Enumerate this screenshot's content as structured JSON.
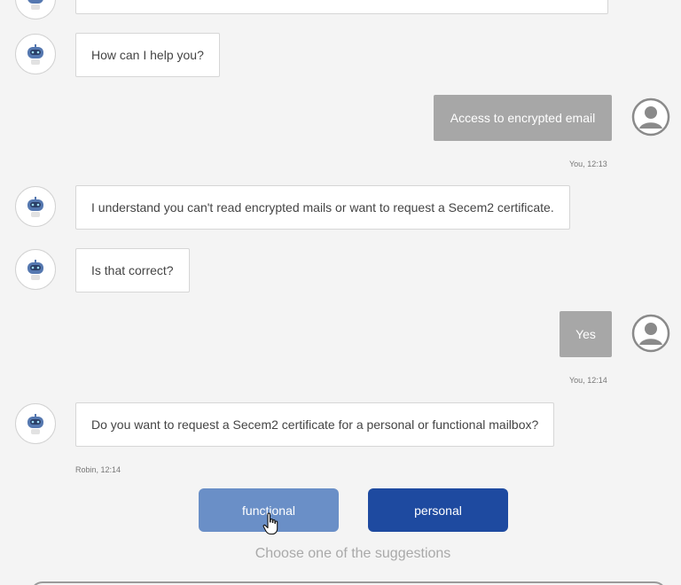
{
  "messages": {
    "bot_help": "How can I help you?",
    "user_access": "Access to encrypted email",
    "user_access_meta": "You, 12:13",
    "bot_understand": "I understand you can't read encrypted mails or want to request a Secem2 certificate.",
    "bot_correct": "Is that correct?",
    "user_yes": "Yes",
    "user_yes_meta": "You, 12:14",
    "bot_request": "Do you want to request a Secem2 certificate for a personal or functional mailbox?",
    "bot_request_meta": "Robin, 12:14"
  },
  "suggestions": {
    "functional_label": "functional",
    "personal_label": "personal",
    "hint": "Choose one of the suggestions"
  },
  "colors": {
    "functional_button": "#6a8fc7",
    "personal_button": "#1e4aa0",
    "user_bubble": "#a7a7a7",
    "background": "#f4f4f4"
  },
  "icons": {
    "bot": "robot-avatar-icon",
    "user": "user-avatar-icon",
    "pointer": "hand-pointer-icon"
  }
}
